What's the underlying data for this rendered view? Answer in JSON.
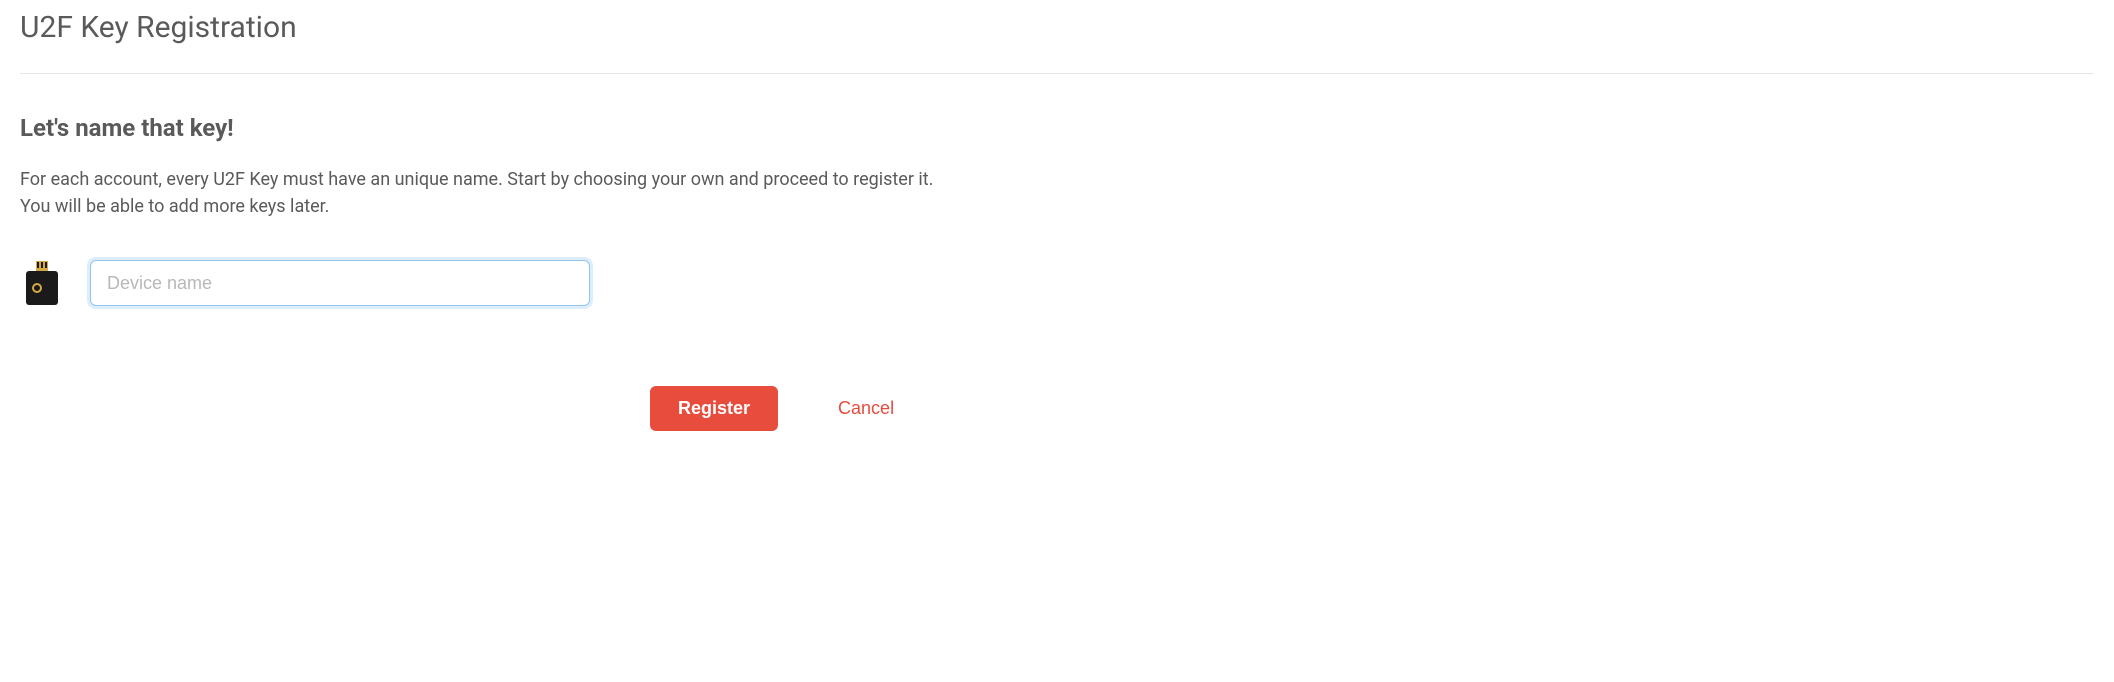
{
  "header": {
    "title": "U2F Key Registration"
  },
  "main": {
    "subtitle": "Let's name that key!",
    "description_line1": "For each account, every U2F Key must have an unique name. Start by choosing your own and proceed to register it.",
    "description_line2": "You will be able to add more keys later.",
    "device_input_placeholder": "Device name",
    "device_input_value": ""
  },
  "actions": {
    "register_label": "Register",
    "cancel_label": "Cancel"
  },
  "colors": {
    "accent": "#e74c3c",
    "input_focus": "#8fc5f0",
    "text": "#5a5a5a"
  }
}
